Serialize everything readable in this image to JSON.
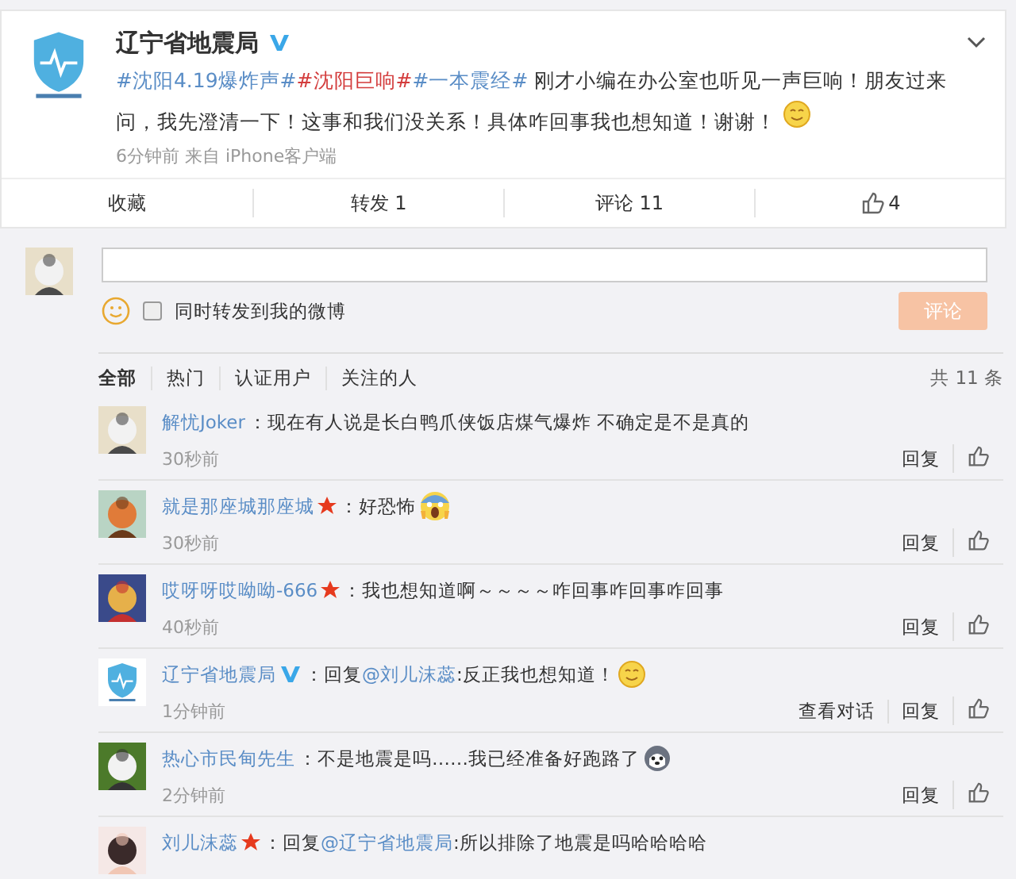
{
  "post": {
    "author": "辽宁省地震局",
    "verified": true,
    "segments": [
      {
        "kind": "topic",
        "text": "#沈阳4.19爆炸声#"
      },
      {
        "kind": "hot",
        "text": "#沈阳巨响#"
      },
      {
        "kind": "topic",
        "text": "#一本震经#"
      },
      {
        "kind": "plain",
        "text": " 刚才小编在办公室也听见一声巨响！朋友过来问，我先澄清一下！这事和我们没关系！具体咋回事我也想知道！谢谢！"
      }
    ],
    "emoji": {
      "kind": "smile"
    },
    "meta": "6分钟前 来自 iPhone客户端"
  },
  "actions": [
    {
      "kind": "text",
      "label": "收藏"
    },
    {
      "kind": "text",
      "label": "转发 1"
    },
    {
      "kind": "text",
      "label": "评论 11"
    },
    {
      "kind": "like",
      "label": "4"
    }
  ],
  "composer": {
    "share_label": "同时转发到我的微博",
    "share_checked": false,
    "submit": "评论"
  },
  "filters": [
    {
      "label": "全部",
      "selected": true
    },
    {
      "label": "热门",
      "selected": false
    },
    {
      "label": "认证用户",
      "selected": false
    },
    {
      "label": "关注的人",
      "selected": false
    }
  ],
  "total": "共 11 条",
  "comments": [
    {
      "user": "解忧Joker",
      "starred": false,
      "verified": false,
      "segments": [
        {
          "kind": "plain",
          "text": "：现在有人说是长白鸭爪侠饭店煤气爆炸 不确定是不是真的"
        }
      ],
      "time": "30秒前",
      "actions": [
        "回复"
      ]
    },
    {
      "user": "就是那座城那座城",
      "starred": true,
      "verified": false,
      "segments": [
        {
          "kind": "plain",
          "text": "：好恐怖"
        }
      ],
      "emoji": {
        "kind": "scream"
      },
      "time": "30秒前",
      "actions": [
        "回复"
      ]
    },
    {
      "user": "哎呀呀哎呦呦-666",
      "starred": true,
      "verified": false,
      "segments": [
        {
          "kind": "plain",
          "text": "：我也想知道啊～～～～咋回事咋回事咋回事"
        }
      ],
      "time": "40秒前",
      "actions": [
        "回复"
      ]
    },
    {
      "user": "辽宁省地震局",
      "starred": false,
      "verified": true,
      "segments": [
        {
          "kind": "plain",
          "text": "：回复"
        },
        {
          "kind": "mention",
          "text": "@刘儿沫蕊"
        },
        {
          "kind": "plain",
          "text": ":反正我也想知道！"
        }
      ],
      "emoji": {
        "kind": "smile"
      },
      "time": "1分钟前",
      "actions": [
        "查看对话",
        "回复"
      ]
    },
    {
      "user": "热心市民甸先生",
      "starred": false,
      "verified": false,
      "segments": [
        {
          "kind": "plain",
          "text": "：不是地震是吗……我已经准备好跑路了"
        }
      ],
      "emoji": {
        "kind": "dog"
      },
      "time": "2分钟前",
      "actions": [
        "回复"
      ]
    },
    {
      "user": "刘儿沫蕊",
      "starred": true,
      "verified": false,
      "segments": [
        {
          "kind": "plain",
          "text": "：回复"
        },
        {
          "kind": "mention",
          "text": "@辽宁省地震局"
        },
        {
          "kind": "plain",
          "text": ":所以排除了地震是吗哈哈哈哈"
        }
      ]
    }
  ]
}
